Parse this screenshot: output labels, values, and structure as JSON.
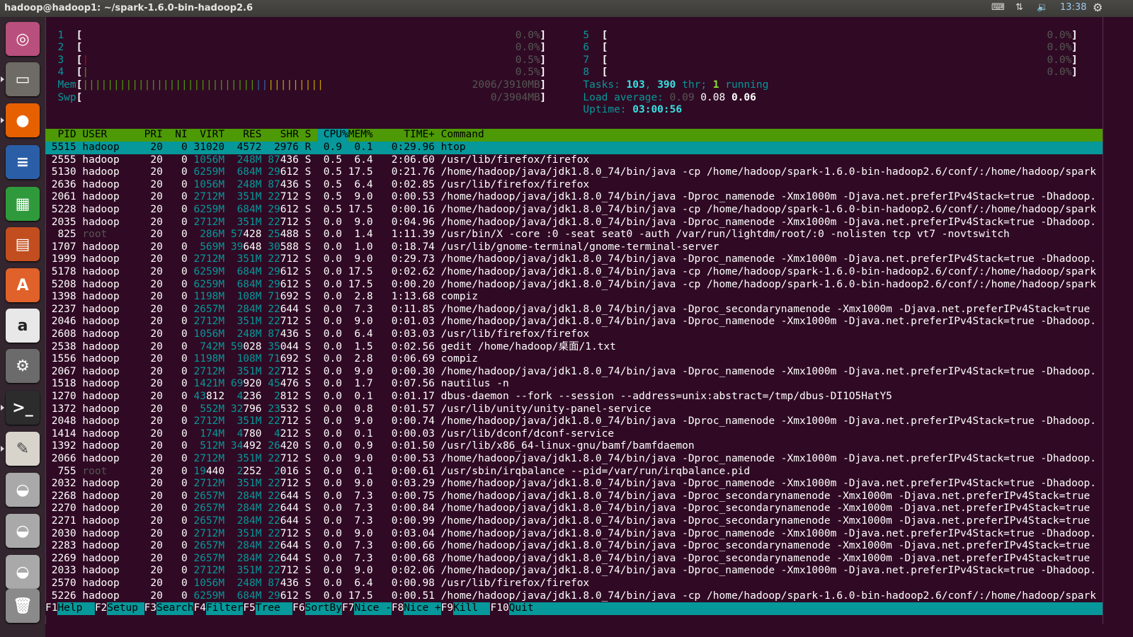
{
  "window": {
    "title": "hadoop@hadoop1: ~/spark-1.6.0-bin-hadoop2.6",
    "clock": "13:38"
  },
  "indicators": [
    "keyboard-icon",
    "network-icon",
    "volume-icon",
    "gear-icon"
  ],
  "launcher": [
    {
      "name": "ubuntu-dash",
      "color": "#b94f7c",
      "glyph": "◎"
    },
    {
      "name": "files",
      "color": "#6e6a65",
      "glyph": "▭"
    },
    {
      "name": "firefox",
      "color": "#e66000",
      "glyph": "●"
    },
    {
      "name": "libreoffice-writer",
      "color": "#2a5fa8",
      "glyph": "≡"
    },
    {
      "name": "libreoffice-calc",
      "color": "#2f9a3c",
      "glyph": "▦"
    },
    {
      "name": "libreoffice-impress",
      "color": "#c24e1f",
      "glyph": "▤"
    },
    {
      "name": "software-center",
      "color": "#e0622a",
      "glyph": "A"
    },
    {
      "name": "amazon",
      "color": "#e8e8e8",
      "glyph": "a"
    },
    {
      "name": "system-settings",
      "color": "#6b6b6b",
      "glyph": "⚙"
    },
    {
      "name": "terminal",
      "color": "#2c2c2c",
      "glyph": ">_"
    },
    {
      "name": "text-editor",
      "color": "#d8d4cc",
      "glyph": "✎"
    },
    {
      "name": "disk-1",
      "color": "#a9a9a9",
      "glyph": "◒"
    },
    {
      "name": "disk-2",
      "color": "#a9a9a9",
      "glyph": "◒"
    },
    {
      "name": "disk-3",
      "color": "#a9a9a9",
      "glyph": "◒"
    },
    {
      "name": "trash",
      "color": "#8a8a8a",
      "glyph": "🗑"
    }
  ],
  "meters": {
    "cpus": [
      {
        "id": "1",
        "value": "0.0%",
        "bar": ""
      },
      {
        "id": "2",
        "value": "0.0%",
        "bar": ""
      },
      {
        "id": "3",
        "value": "0.5%",
        "bar": "red"
      },
      {
        "id": "4",
        "value": "0.5%",
        "bar": "grn"
      },
      {
        "id": "5",
        "value": "0.0%",
        "bar": ""
      },
      {
        "id": "6",
        "value": "0.0%",
        "bar": ""
      },
      {
        "id": "7",
        "value": "0.0%",
        "bar": ""
      },
      {
        "id": "8",
        "value": "0.0%",
        "bar": ""
      }
    ],
    "mem": {
      "label": "Mem",
      "value": "2006/3910MB",
      "used_pct": 39,
      "buffers_pct": 3,
      "cache_pct": 13
    },
    "swp": {
      "label": "Swp",
      "value": "0/3904MB"
    },
    "tasks": {
      "label": "Tasks: ",
      "count": "103",
      "sep": ", ",
      "threads": "390",
      "thr_label": " thr; ",
      "running": "1",
      "running_label": " running"
    },
    "load": {
      "label": "Load average: ",
      "l1": "0.09",
      "l5": "0.08",
      "l15": "0.06"
    },
    "uptime": {
      "label": "Uptime: ",
      "value": "03:00:56"
    }
  },
  "table": {
    "columns": [
      "PID",
      "USER",
      "PRI",
      "NI",
      "VIRT",
      "RES",
      "SHR",
      "S",
      "CPU%",
      "MEM%",
      "TIME+",
      "Command"
    ],
    "sort_column": "CPU%",
    "selected_pid": "5515",
    "rows": [
      [
        "5515",
        "hadoop",
        "20",
        "0",
        "31020",
        "4572",
        "2976",
        "R",
        "0.9",
        "0.1",
        "0:29.96",
        "htop"
      ],
      [
        "2555",
        "hadoop",
        "20",
        "0",
        "1056M",
        "248M",
        "87436",
        "S",
        "0.5",
        "6.4",
        "2:06.60",
        "/usr/lib/firefox/firefox"
      ],
      [
        "5130",
        "hadoop",
        "20",
        "0",
        "6259M",
        "684M",
        "29612",
        "S",
        "0.5",
        "17.5",
        "0:21.76",
        "/home/hadoop/java/jdk1.8.0_74/bin/java -cp /home/hadoop/spark-1.6.0-bin-hadoop2.6/conf/:/home/hadoop/spark"
      ],
      [
        "2636",
        "hadoop",
        "20",
        "0",
        "1056M",
        "248M",
        "87436",
        "S",
        "0.5",
        "6.4",
        "0:02.85",
        "/usr/lib/firefox/firefox"
      ],
      [
        "2061",
        "hadoop",
        "20",
        "0",
        "2712M",
        "351M",
        "22712",
        "S",
        "0.5",
        "9.0",
        "0:00.53",
        "/home/hadoop/java/jdk1.8.0_74/bin/java -Dproc_namenode -Xmx1000m -Djava.net.preferIPv4Stack=true -Dhadoop."
      ],
      [
        "5228",
        "hadoop",
        "20",
        "0",
        "6259M",
        "684M",
        "29612",
        "S",
        "0.5",
        "17.5",
        "0:00.16",
        "/home/hadoop/java/jdk1.8.0_74/bin/java -cp /home/hadoop/spark-1.6.0-bin-hadoop2.6/conf/:/home/hadoop/spark"
      ],
      [
        "2035",
        "hadoop",
        "20",
        "0",
        "2712M",
        "351M",
        "22712",
        "S",
        "0.0",
        "9.0",
        "0:04.96",
        "/home/hadoop/java/jdk1.8.0_74/bin/java -Dproc_namenode -Xmx1000m -Djava.net.preferIPv4Stack=true -Dhadoop."
      ],
      [
        "825",
        "root",
        "20",
        "0",
        "286M",
        "57428",
        "25488",
        "S",
        "0.0",
        "1.4",
        "1:11.39",
        "/usr/bin/X -core :0 -seat seat0 -auth /var/run/lightdm/root/:0 -nolisten tcp vt7 -novtswitch"
      ],
      [
        "1707",
        "hadoop",
        "20",
        "0",
        "569M",
        "39648",
        "30588",
        "S",
        "0.0",
        "1.0",
        "0:18.74",
        "/usr/lib/gnome-terminal/gnome-terminal-server"
      ],
      [
        "1999",
        "hadoop",
        "20",
        "0",
        "2712M",
        "351M",
        "22712",
        "S",
        "0.0",
        "9.0",
        "0:29.73",
        "/home/hadoop/java/jdk1.8.0_74/bin/java -Dproc_namenode -Xmx1000m -Djava.net.preferIPv4Stack=true -Dhadoop."
      ],
      [
        "5178",
        "hadoop",
        "20",
        "0",
        "6259M",
        "684M",
        "29612",
        "S",
        "0.0",
        "17.5",
        "0:02.62",
        "/home/hadoop/java/jdk1.8.0_74/bin/java -cp /home/hadoop/spark-1.6.0-bin-hadoop2.6/conf/:/home/hadoop/spark"
      ],
      [
        "5208",
        "hadoop",
        "20",
        "0",
        "6259M",
        "684M",
        "29612",
        "S",
        "0.0",
        "17.5",
        "0:00.20",
        "/home/hadoop/java/jdk1.8.0_74/bin/java -cp /home/hadoop/spark-1.6.0-bin-hadoop2.6/conf/:/home/hadoop/spark"
      ],
      [
        "1398",
        "hadoop",
        "20",
        "0",
        "1198M",
        "108M",
        "71692",
        "S",
        "0.0",
        "2.8",
        "1:13.68",
        "compiz"
      ],
      [
        "2237",
        "hadoop",
        "20",
        "0",
        "2657M",
        "284M",
        "22644",
        "S",
        "0.0",
        "7.3",
        "0:11.85",
        "/home/hadoop/java/jdk1.8.0_74/bin/java -Dproc_secondarynamenode -Xmx1000m -Djava.net.preferIPv4Stack=true"
      ],
      [
        "2046",
        "hadoop",
        "20",
        "0",
        "2712M",
        "351M",
        "22712",
        "S",
        "0.0",
        "9.0",
        "0:01.03",
        "/home/hadoop/java/jdk1.8.0_74/bin/java -Dproc_namenode -Xmx1000m -Djava.net.preferIPv4Stack=true -Dhadoop."
      ],
      [
        "2608",
        "hadoop",
        "20",
        "0",
        "1056M",
        "248M",
        "87436",
        "S",
        "0.0",
        "6.4",
        "0:03.03",
        "/usr/lib/firefox/firefox"
      ],
      [
        "2538",
        "hadoop",
        "20",
        "0",
        "742M",
        "59028",
        "35044",
        "S",
        "0.0",
        "1.5",
        "0:02.56",
        "gedit /home/hadoop/桌面/1.txt"
      ],
      [
        "1556",
        "hadoop",
        "20",
        "0",
        "1198M",
        "108M",
        "71692",
        "S",
        "0.0",
        "2.8",
        "0:06.69",
        "compiz"
      ],
      [
        "2067",
        "hadoop",
        "20",
        "0",
        "2712M",
        "351M",
        "22712",
        "S",
        "0.0",
        "9.0",
        "0:00.30",
        "/home/hadoop/java/jdk1.8.0_74/bin/java -Dproc_namenode -Xmx1000m -Djava.net.preferIPv4Stack=true -Dhadoop."
      ],
      [
        "1518",
        "hadoop",
        "20",
        "0",
        "1421M",
        "69920",
        "45476",
        "S",
        "0.0",
        "1.7",
        "0:07.56",
        "nautilus -n"
      ],
      [
        "1270",
        "hadoop",
        "20",
        "0",
        "43812",
        "4236",
        "2812",
        "S",
        "0.0",
        "0.1",
        "0:01.17",
        "dbus-daemon --fork --session --address=unix:abstract=/tmp/dbus-DI1O5HatY5"
      ],
      [
        "1372",
        "hadoop",
        "20",
        "0",
        "552M",
        "32796",
        "23532",
        "S",
        "0.0",
        "0.8",
        "0:01.57",
        "/usr/lib/unity/unity-panel-service"
      ],
      [
        "2048",
        "hadoop",
        "20",
        "0",
        "2712M",
        "351M",
        "22712",
        "S",
        "0.0",
        "9.0",
        "0:00.74",
        "/home/hadoop/java/jdk1.8.0_74/bin/java -Dproc_namenode -Xmx1000m -Djava.net.preferIPv4Stack=true -Dhadoop."
      ],
      [
        "1414",
        "hadoop",
        "20",
        "0",
        "174M",
        "4780",
        "4212",
        "S",
        "0.0",
        "0.1",
        "0:00.03",
        "/usr/lib/dconf/dconf-service"
      ],
      [
        "1392",
        "hadoop",
        "20",
        "0",
        "512M",
        "34492",
        "26420",
        "S",
        "0.0",
        "0.9",
        "0:01.50",
        "/usr/lib/x86_64-linux-gnu/bamf/bamfdaemon"
      ],
      [
        "2066",
        "hadoop",
        "20",
        "0",
        "2712M",
        "351M",
        "22712",
        "S",
        "0.0",
        "9.0",
        "0:00.53",
        "/home/hadoop/java/jdk1.8.0_74/bin/java -Dproc_namenode -Xmx1000m -Djava.net.preferIPv4Stack=true -Dhadoop."
      ],
      [
        "755",
        "root",
        "20",
        "0",
        "19440",
        "2252",
        "2016",
        "S",
        "0.0",
        "0.1",
        "0:00.61",
        "/usr/sbin/irqbalance --pid=/var/run/irqbalance.pid"
      ],
      [
        "2032",
        "hadoop",
        "20",
        "0",
        "2712M",
        "351M",
        "22712",
        "S",
        "0.0",
        "9.0",
        "0:03.29",
        "/home/hadoop/java/jdk1.8.0_74/bin/java -Dproc_namenode -Xmx1000m -Djava.net.preferIPv4Stack=true -Dhadoop."
      ],
      [
        "2268",
        "hadoop",
        "20",
        "0",
        "2657M",
        "284M",
        "22644",
        "S",
        "0.0",
        "7.3",
        "0:00.75",
        "/home/hadoop/java/jdk1.8.0_74/bin/java -Dproc_secondarynamenode -Xmx1000m -Djava.net.preferIPv4Stack=true"
      ],
      [
        "2270",
        "hadoop",
        "20",
        "0",
        "2657M",
        "284M",
        "22644",
        "S",
        "0.0",
        "7.3",
        "0:00.84",
        "/home/hadoop/java/jdk1.8.0_74/bin/java -Dproc_secondarynamenode -Xmx1000m -Djava.net.preferIPv4Stack=true"
      ],
      [
        "2271",
        "hadoop",
        "20",
        "0",
        "2657M",
        "284M",
        "22644",
        "S",
        "0.0",
        "7.3",
        "0:00.99",
        "/home/hadoop/java/jdk1.8.0_74/bin/java -Dproc_secondarynamenode -Xmx1000m -Djava.net.preferIPv4Stack=true"
      ],
      [
        "2030",
        "hadoop",
        "20",
        "0",
        "2712M",
        "351M",
        "22712",
        "S",
        "0.0",
        "9.0",
        "0:03.04",
        "/home/hadoop/java/jdk1.8.0_74/bin/java -Dproc_namenode -Xmx1000m -Djava.net.preferIPv4Stack=true -Dhadoop."
      ],
      [
        "2283",
        "hadoop",
        "20",
        "0",
        "2657M",
        "284M",
        "22644",
        "S",
        "0.0",
        "7.3",
        "0:00.66",
        "/home/hadoop/java/jdk1.8.0_74/bin/java -Dproc_secondarynamenode -Xmx1000m -Djava.net.preferIPv4Stack=true"
      ],
      [
        "2269",
        "hadoop",
        "20",
        "0",
        "2657M",
        "284M",
        "22644",
        "S",
        "0.0",
        "7.3",
        "0:00.68",
        "/home/hadoop/java/jdk1.8.0_74/bin/java -Dproc_secondarynamenode -Xmx1000m -Djava.net.preferIPv4Stack=true"
      ],
      [
        "2033",
        "hadoop",
        "20",
        "0",
        "2712M",
        "351M",
        "22712",
        "S",
        "0.0",
        "9.0",
        "0:02.06",
        "/home/hadoop/java/jdk1.8.0_74/bin/java -Dproc_namenode -Xmx1000m -Djava.net.preferIPv4Stack=true -Dhadoop."
      ],
      [
        "2570",
        "hadoop",
        "20",
        "0",
        "1056M",
        "248M",
        "87436",
        "S",
        "0.0",
        "6.4",
        "0:00.98",
        "/usr/lib/firefox/firefox"
      ],
      [
        "5226",
        "hadoop",
        "20",
        "0",
        "6259M",
        "684M",
        "29612",
        "S",
        "0.0",
        "17.5",
        "0:00.51",
        "/home/hadoop/java/jdk1.8.0_74/bin/java -cp /home/hadoop/spark-1.6.0-bin-hadoop2.6/conf/:/home/hadoop/spark"
      ]
    ]
  },
  "function_keys": [
    {
      "key": "F1",
      "label": "Help  "
    },
    {
      "key": "F2",
      "label": "Setup "
    },
    {
      "key": "F3",
      "label": "Search"
    },
    {
      "key": "F4",
      "label": "Filter"
    },
    {
      "key": "F5",
      "label": "Tree  "
    },
    {
      "key": "F6",
      "label": "SortBy"
    },
    {
      "key": "F7",
      "label": "Nice -"
    },
    {
      "key": "F8",
      "label": "Nice +"
    },
    {
      "key": "F9",
      "label": "Kill  "
    },
    {
      "key": "F10",
      "label": "Quit"
    }
  ],
  "colors": {
    "terminal_bg": "#300a24",
    "teal": "#06989a",
    "header_green": "#4e9a06"
  }
}
